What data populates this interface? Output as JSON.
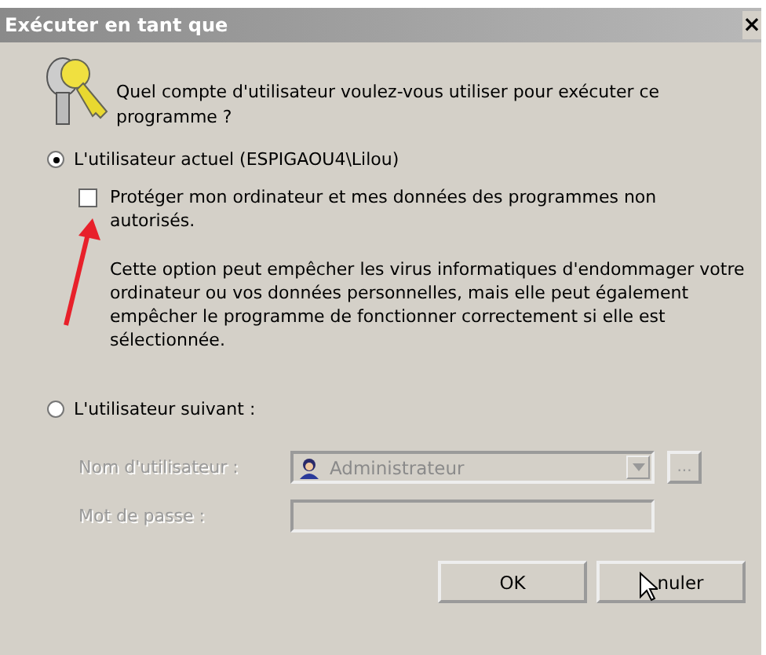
{
  "window": {
    "title": "Exécuter en tant que",
    "close": "×"
  },
  "question": "Quel compte d'utilisateur voulez-vous utiliser pour exécuter ce programme ?",
  "options": [
    {
      "label": "L'utilisateur actuel (ESPIGAOU4\\Lilou)",
      "selected": true
    },
    {
      "label": "L'utilisateur suivant :",
      "selected": false
    }
  ],
  "protect": {
    "label": "Protéger mon ordinateur et mes données des programmes non autorisés.",
    "checked": false,
    "note": "Cette option peut empêcher les virus informatiques d'endommager votre ordinateur ou vos données personnelles, mais elle peut également empêcher le programme de fonctionner correctement si elle est sélectionnée."
  },
  "credentials": {
    "disabled": true,
    "username_label": "Nom d'utilisateur :",
    "username": "Administrateur",
    "browse": "...",
    "password_label": "Mot de passe :"
  },
  "buttons": [
    {
      "label": "OK",
      "kind": "plain"
    },
    {
      "label": "nuler",
      "kind": "cursor"
    }
  ]
}
